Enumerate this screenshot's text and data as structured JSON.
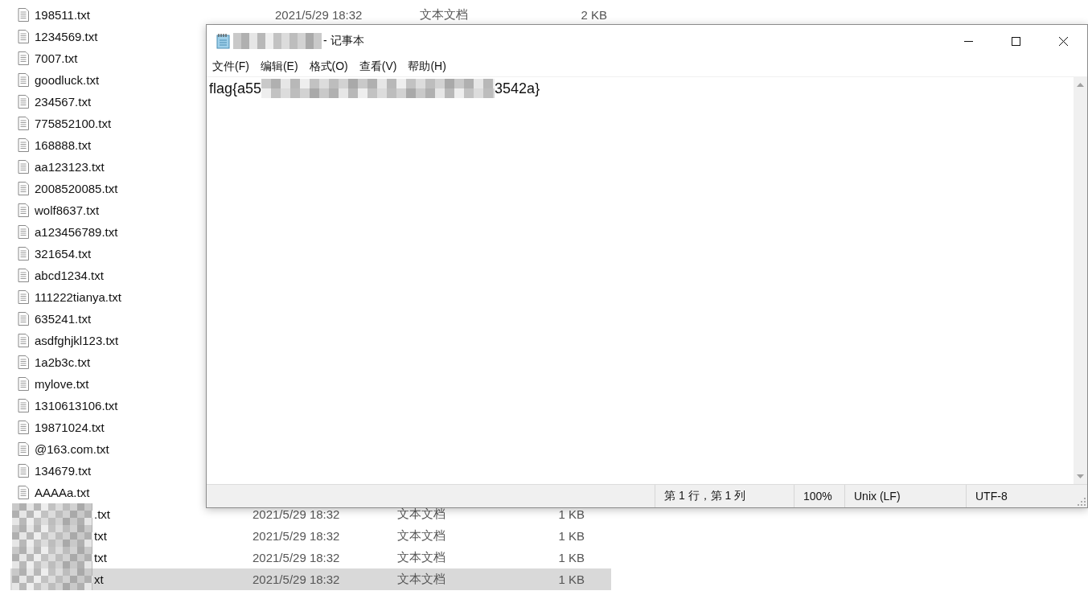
{
  "files": [
    {
      "name": "198511.txt",
      "date": "2021/5/29 18:32",
      "type": "文本文档",
      "size": "2 KB",
      "selected": false
    },
    {
      "name": "1234569.txt",
      "selected": false
    },
    {
      "name": "7007.txt",
      "selected": false
    },
    {
      "name": "goodluck.txt",
      "selected": false
    },
    {
      "name": "234567.txt",
      "selected": false
    },
    {
      "name": "775852100.txt",
      "selected": false
    },
    {
      "name": "168888.txt",
      "selected": false
    },
    {
      "name": "aa123123.txt",
      "selected": false
    },
    {
      "name": "2008520085.txt",
      "selected": false
    },
    {
      "name": "wolf8637.txt",
      "selected": false
    },
    {
      "name": "a123456789.txt",
      "selected": false
    },
    {
      "name": "321654.txt",
      "selected": false
    },
    {
      "name": "abcd1234.txt",
      "selected": false
    },
    {
      "name": "111222tianya.txt",
      "selected": false
    },
    {
      "name": "635241.txt",
      "selected": false
    },
    {
      "name": "asdfghjkl123.txt",
      "selected": false
    },
    {
      "name": "1a2b3c.txt",
      "selected": false
    },
    {
      "name": "mylove.txt",
      "selected": false
    },
    {
      "name": "1310613106.txt",
      "selected": false
    },
    {
      "name": "19871024.txt",
      "selected": false
    },
    {
      "name": "@163.com.txt",
      "selected": false
    },
    {
      "name": "134679.txt",
      "selected": false
    },
    {
      "name": "AAAAa.txt",
      "selected": false
    },
    {
      "name": ".txt",
      "redacted": true,
      "date": "2021/5/29 18:32",
      "type": "文本文档",
      "size": "1 KB",
      "selected": false
    },
    {
      "name": "txt",
      "redacted": true,
      "date": "2021/5/29 18:32",
      "type": "文本文档",
      "size": "1 KB",
      "selected": false
    },
    {
      "name": "txt",
      "redacted": true,
      "date": "2021/5/29 18:32",
      "type": "文本文档",
      "size": "1 KB",
      "selected": false
    },
    {
      "name": "xt",
      "redacted": true,
      "date": "2021/5/29 18:32",
      "type": "文本文档",
      "size": "1 KB",
      "selected": true
    }
  ],
  "notepad": {
    "title": "- 记事本",
    "menu": [
      "文件(F)",
      "编辑(E)",
      "格式(O)",
      "查看(V)",
      "帮助(H)"
    ],
    "text_start": "flag{a55",
    "text_end": "3542a}",
    "status": [
      "第 1 行，第 1 列",
      "100%",
      "Unix (LF)",
      "UTF-8"
    ]
  }
}
